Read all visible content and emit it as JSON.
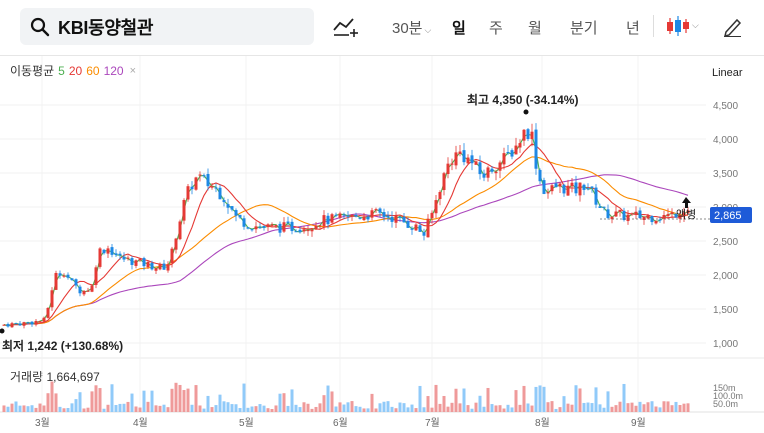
{
  "header": {
    "stock_name": "KBI동양철관",
    "periods": [
      {
        "label": "30분",
        "active": false
      },
      {
        "label": "일",
        "active": true
      },
      {
        "label": "주",
        "active": false
      },
      {
        "label": "월",
        "active": false
      },
      {
        "label": "분기",
        "active": false
      },
      {
        "label": "년",
        "active": false
      }
    ],
    "icons": [
      "search-icon",
      "chart-tool-icon",
      "candle-type-icon",
      "pen-icon"
    ]
  },
  "legend": {
    "title": "이동평균",
    "ma": [
      {
        "label": "5",
        "color": "#4caf50"
      },
      {
        "label": "20",
        "color": "#e53935"
      },
      {
        "label": "60",
        "color": "#fb8c00"
      },
      {
        "label": "120",
        "color": "#ab47bc"
      }
    ],
    "close_mark": "×"
  },
  "scale_mode": "Linear",
  "annotations": {
    "high": "최고 4,350 (-34.14%)",
    "low": "최저 1,242 (+130.68%)",
    "current_price": "2,865",
    "marker": "액병"
  },
  "volume": {
    "label": "거래량",
    "value": "1,664,697"
  },
  "colors": {
    "up": "#e53935",
    "down": "#1e88e5",
    "price_tag": "#1e5bd8"
  },
  "chart_data": {
    "type": "candlestick",
    "y_ticks": [
      "4,500",
      "4,000",
      "3,500",
      "3,000",
      "2,500",
      "2,000",
      "1,500",
      "1,000"
    ],
    "y_values": [
      4500,
      4000,
      3500,
      3000,
      2500,
      2000,
      1500,
      1000
    ],
    "x_labels": [
      "3월",
      "4월",
      "5월",
      "6월",
      "7월",
      "8월",
      "9월"
    ],
    "volume_ticks": [
      "150m",
      "100.0m",
      "50.0m"
    ],
    "ylim": [
      800,
      4700
    ],
    "high": 4350,
    "low": 1242,
    "last": 2865
  }
}
